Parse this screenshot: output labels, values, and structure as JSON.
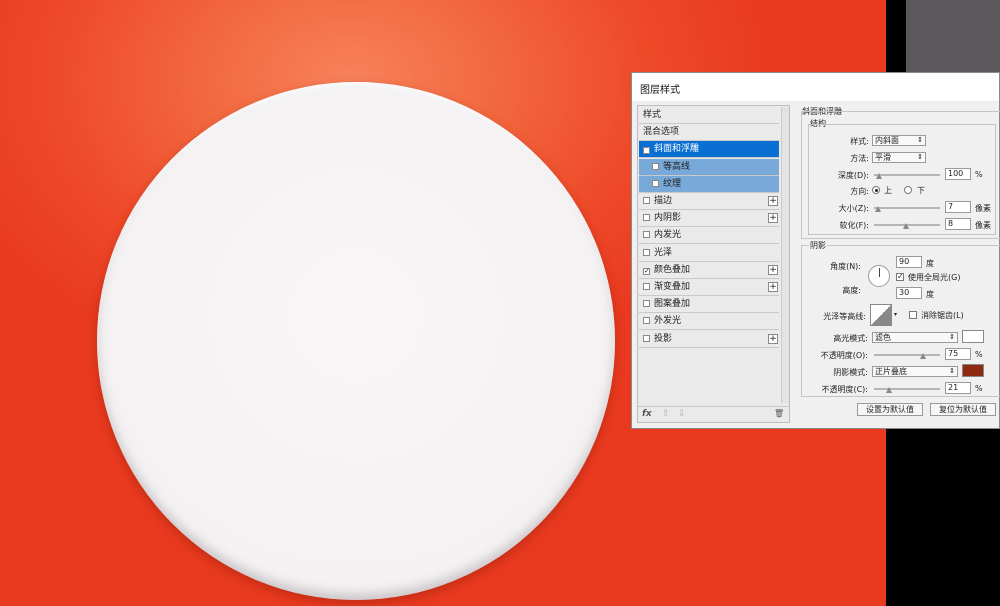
{
  "dialog": {
    "title": "图层样式"
  },
  "style_list": {
    "items": [
      {
        "label": "样式",
        "checkbox": false,
        "checked": false,
        "plus": false,
        "state": "header"
      },
      {
        "label": "混合选项",
        "checkbox": false,
        "checked": false,
        "plus": false,
        "state": "normal"
      },
      {
        "label": "斜面和浮雕",
        "checkbox": true,
        "checked": true,
        "plus": false,
        "state": "selected"
      },
      {
        "label": "等高线",
        "checkbox": true,
        "checked": false,
        "plus": false,
        "state": "sub"
      },
      {
        "label": "纹理",
        "checkbox": true,
        "checked": false,
        "plus": false,
        "state": "sub"
      },
      {
        "label": "描边",
        "checkbox": true,
        "checked": false,
        "plus": true,
        "state": "normal"
      },
      {
        "label": "内阴影",
        "checkbox": true,
        "checked": false,
        "plus": true,
        "state": "normal"
      },
      {
        "label": "内发光",
        "checkbox": true,
        "checked": false,
        "plus": false,
        "state": "normal"
      },
      {
        "label": "光泽",
        "checkbox": true,
        "checked": false,
        "plus": false,
        "state": "normal"
      },
      {
        "label": "颜色叠加",
        "checkbox": true,
        "checked": true,
        "plus": true,
        "state": "normal"
      },
      {
        "label": "渐变叠加",
        "checkbox": true,
        "checked": false,
        "plus": true,
        "state": "normal"
      },
      {
        "label": "图案叠加",
        "checkbox": true,
        "checked": false,
        "plus": false,
        "state": "normal"
      },
      {
        "label": "外发光",
        "checkbox": true,
        "checked": false,
        "plus": false,
        "state": "normal"
      },
      {
        "label": "投影",
        "checkbox": true,
        "checked": false,
        "plus": true,
        "state": "normal"
      }
    ],
    "footer": {
      "fx": "fx",
      "up": "⇧",
      "down": "⇩",
      "trash": "🗑"
    }
  },
  "bevel": {
    "section_title": "斜面和浮雕",
    "structure_title": "结构",
    "style_label": "样式:",
    "style_value": "内斜面",
    "technique_label": "方法:",
    "technique_value": "平滑",
    "depth_label": "深度(D):",
    "depth_value": "100",
    "depth_unit": "%",
    "direction_label": "方向:",
    "direction_up": "上",
    "direction_down": "下",
    "size_label": "大小(Z):",
    "size_value": "7",
    "size_unit": "像素",
    "soften_label": "软化(F):",
    "soften_value": "8",
    "soften_unit": "像素"
  },
  "shading": {
    "title": "阴影",
    "angle_label": "角度(N):",
    "angle_value": "90",
    "angle_unit": "度",
    "global_light_label": "使用全局光(G)",
    "altitude_label": "高度:",
    "altitude_value": "30",
    "altitude_unit": "度",
    "gloss_contour_label": "光泽等高线:",
    "anti_alias_label": "消除锯齿(L)",
    "highlight_mode_label": "高光模式:",
    "highlight_mode_value": "滤色",
    "highlight_color": "#ffffff",
    "highlight_opacity_label": "不透明度(O):",
    "highlight_opacity_value": "75",
    "highlight_opacity_unit": "%",
    "shadow_mode_label": "阴影模式:",
    "shadow_mode_value": "正片叠底",
    "shadow_color": "#8f2a12",
    "shadow_opacity_label": "不透明度(C):",
    "shadow_opacity_value": "21",
    "shadow_opacity_unit": "%"
  },
  "buttons": {
    "make_default": "设置为默认值",
    "reset_default": "复位为默认值"
  }
}
